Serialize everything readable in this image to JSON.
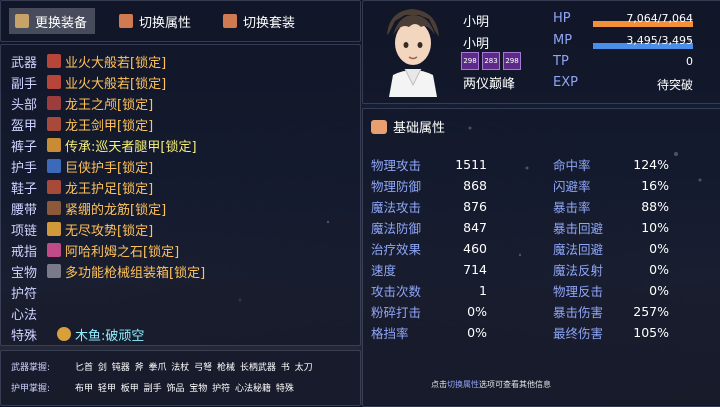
{
  "tabs": [
    {
      "label": "更换装备",
      "icon": "crossed-swords-icon",
      "active": true
    },
    {
      "label": "切换属性",
      "icon": "armor-shirt-icon",
      "active": false
    },
    {
      "label": "切换套装",
      "icon": "armor-shirt-icon",
      "active": false
    }
  ],
  "equipment": [
    {
      "slot": "武器",
      "item": "业火大般若[锁定]",
      "icon": "sword-icon",
      "color": "orange"
    },
    {
      "slot": "副手",
      "item": "业火大般若[锁定]",
      "icon": "sword-icon",
      "color": "orange"
    },
    {
      "slot": "头部",
      "item": "龙王之颅[锁定]",
      "icon": "helmet-icon",
      "color": "orange"
    },
    {
      "slot": "盔甲",
      "item": "龙王剑甲[锁定]",
      "icon": "armor-icon",
      "color": "orange"
    },
    {
      "slot": "裤子",
      "item": "传承:巡天者腿甲[锁定]",
      "icon": "leg-armor-icon",
      "color": "yellow"
    },
    {
      "slot": "护手",
      "item": "巨侠护手[锁定]",
      "icon": "glove-icon",
      "color": "orange"
    },
    {
      "slot": "鞋子",
      "item": "龙王护足[锁定]",
      "icon": "boot-icon",
      "color": "orange"
    },
    {
      "slot": "腰带",
      "item": "紧绷的龙筋[锁定]",
      "icon": "belt-icon",
      "color": "orange"
    },
    {
      "slot": "项链",
      "item": "无尽攻势[锁定]",
      "icon": "necklace-icon",
      "color": "orange"
    },
    {
      "slot": "戒指",
      "item": "阿哈利姆之石[锁定]",
      "icon": "ring-icon",
      "color": "orange"
    },
    {
      "slot": "宝物",
      "item": "多功能枪械组装箱[锁定]",
      "icon": "toolbox-icon",
      "color": "orange"
    },
    {
      "slot": "护符",
      "item": "",
      "icon": "",
      "color": "orange"
    },
    {
      "slot": "心法",
      "item": "",
      "icon": "",
      "color": "orange"
    },
    {
      "slot": "特殊",
      "item": "木鱼:破顽空",
      "icon": "wooden-fish-icon",
      "color": "cyan"
    }
  ],
  "mastery": {
    "weapon_label": "武器掌握:",
    "weapon_values": "匕首 剑 钝器 斧 拳爪 法杖 弓弩 枪械 长柄武器 书 太刀",
    "armor_label": "护甲掌握:",
    "armor_values": "布甲 轻甲 板甲 副手 饰品 宝物 护符 心法秘籍 特殊"
  },
  "character": {
    "name": "小明",
    "name2": "小明",
    "title": "两仪巅峰",
    "states": [
      "298",
      "283",
      "298"
    ],
    "hp_label": "HP",
    "hp_value": "7,064/7,064",
    "hp_ratio": 1.0,
    "hp_color": "#f3903a",
    "mp_label": "MP",
    "mp_value": "3,495/3,495",
    "mp_ratio": 1.0,
    "mp_color": "#4a8ee8",
    "tp_label": "TP",
    "tp_value": "0",
    "exp_label": "EXP",
    "exp_value": "待突破"
  },
  "stats": {
    "title": "基础属性",
    "left": [
      {
        "label": "物理攻击",
        "value": "1511"
      },
      {
        "label": "物理防御",
        "value": "868"
      },
      {
        "label": "魔法攻击",
        "value": "876"
      },
      {
        "label": "魔法防御",
        "value": "847"
      },
      {
        "label": "治疗效果",
        "value": "460"
      },
      {
        "label": "速度",
        "value": "714"
      },
      {
        "label": "攻击次数",
        "value": "1"
      },
      {
        "label": "粉碎打击",
        "value": "0%"
      },
      {
        "label": "格挡率",
        "value": "0%"
      }
    ],
    "right": [
      {
        "label": "命中率",
        "value": "124%"
      },
      {
        "label": "闪避率",
        "value": "16%"
      },
      {
        "label": "暴击率",
        "value": "88%"
      },
      {
        "label": "暴击回避",
        "value": "10%"
      },
      {
        "label": "魔法回避",
        "value": "0%"
      },
      {
        "label": "魔法反射",
        "value": "0%"
      },
      {
        "label": "物理反击",
        "value": "0%"
      },
      {
        "label": "暴击伤害",
        "value": "257%"
      },
      {
        "label": "最终伤害",
        "value": "105%"
      }
    ],
    "hint_pre": "点击",
    "hint_hl": "切换属性",
    "hint_post": "选项可查看其他信息"
  }
}
